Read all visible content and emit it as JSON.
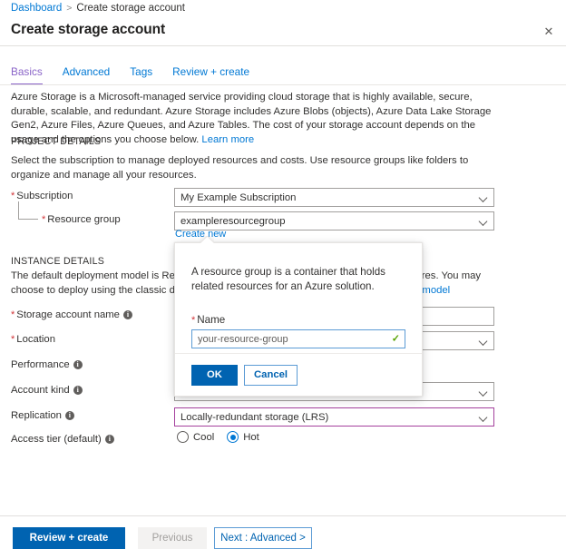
{
  "breadcrumb": {
    "root": "Dashboard",
    "separator": ">",
    "current": "Create storage account"
  },
  "header": {
    "title": "Create storage account",
    "close_glyph": "✕"
  },
  "tabs": [
    {
      "label": "Basics",
      "active": true
    },
    {
      "label": "Advanced",
      "active": false
    },
    {
      "label": "Tags",
      "active": false
    },
    {
      "label": "Review + create",
      "active": false
    }
  ],
  "intro": {
    "text": "Azure Storage is a Microsoft-managed service providing cloud storage that is highly available, secure, durable, scalable, and redundant. Azure Storage includes Azure Blobs (objects), Azure Data Lake Storage Gen2, Azure Files, Azure Queues, and Azure Tables. The cost of your storage account depends on the usage and the options you choose below.",
    "link": "Learn more"
  },
  "project_details": {
    "heading": "PROJECT DETAILS",
    "description": "Select the subscription to manage deployed resources and costs. Use resource groups like folders to organize and manage all your resources.",
    "subscription": {
      "label": "Subscription",
      "required": true,
      "value": "My Example Subscription"
    },
    "resource_group": {
      "label": "Resource group",
      "required": true,
      "value": "exampleresourcegroup",
      "create_new_link": "Create new"
    }
  },
  "instance_details": {
    "heading": "INSTANCE DETAILS",
    "description_before": "The default deployment model is Resource Manager, which supports the latest Azure features. You may choose to deploy using the classic deployment model instead.",
    "description_link": "Choose classic deployment model",
    "fields": [
      {
        "label": "Storage account name",
        "required": true,
        "info": true,
        "value": "",
        "type": "text"
      },
      {
        "label": "Location",
        "required": true,
        "info": false,
        "value": "",
        "type": "select"
      },
      {
        "label": "Performance",
        "required": false,
        "info": true,
        "value": "",
        "type": "none"
      },
      {
        "label": "Account kind",
        "required": false,
        "info": true,
        "value": "",
        "type": "select"
      },
      {
        "label": "Replication",
        "required": false,
        "info": true,
        "value": "Locally-redundant storage (LRS)",
        "type": "select",
        "highlighted": true
      },
      {
        "label": "Access tier (default)",
        "required": false,
        "info": true,
        "type": "radio"
      }
    ],
    "access_tier_options": [
      {
        "label": "Cool",
        "selected": false
      },
      {
        "label": "Hot",
        "selected": true
      }
    ]
  },
  "callout": {
    "body_text": "A resource group is a container that holds related resources for an Azure solution.",
    "name_label": "Name",
    "name_required": true,
    "name_value": "your-resource-group",
    "valid_glyph": "✓",
    "ok_label": "OK",
    "cancel_label": "Cancel"
  },
  "footer": {
    "review_label": "Review + create",
    "previous_label": "Previous",
    "next_label": "Next : Advanced >"
  },
  "colors": {
    "accent_blue": "#0078d4",
    "primary_button": "#0063b1",
    "active_tab_purple": "#8a64c8",
    "required_red": "#d13438",
    "highlight_border": "#a4419d",
    "valid_green": "#57a300"
  }
}
